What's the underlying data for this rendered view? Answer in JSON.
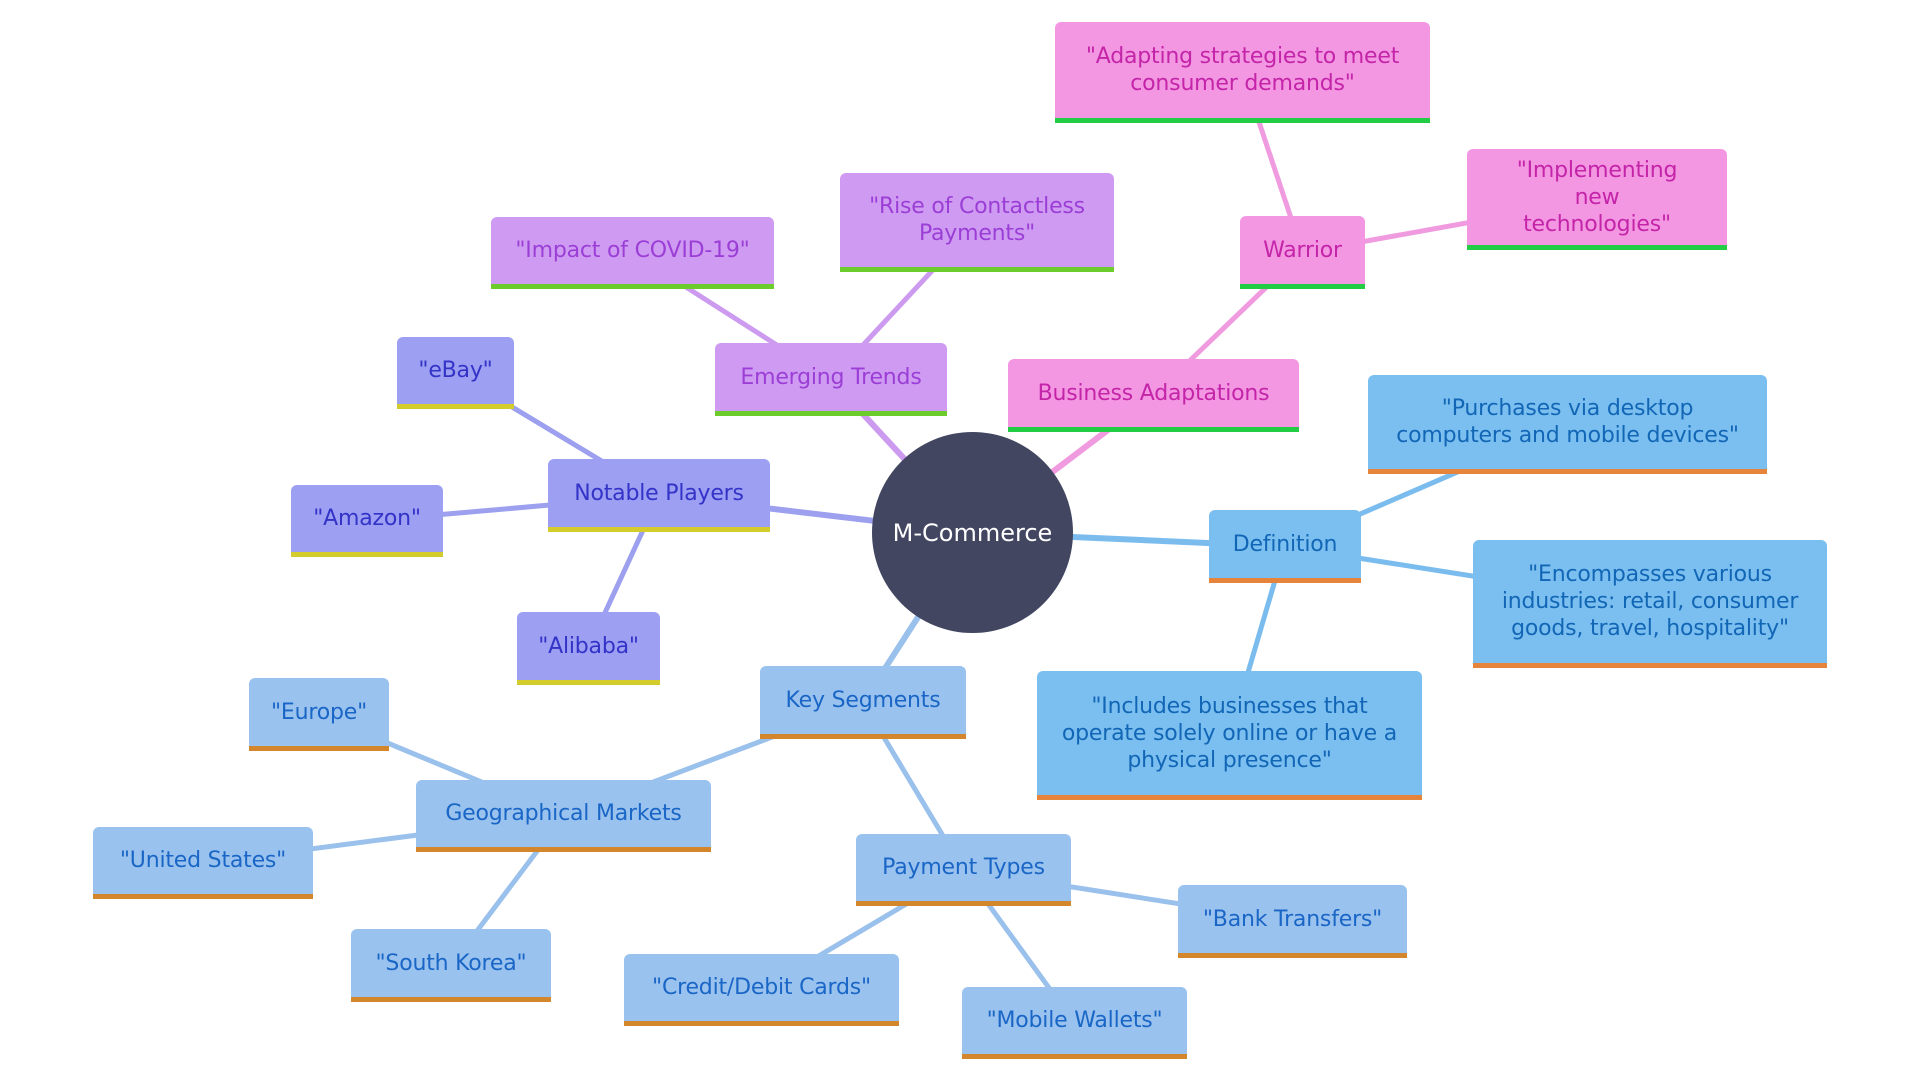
{
  "diagram": {
    "type": "mindmap",
    "root": {
      "id": "root",
      "label": "M-Commerce",
      "color": "#424660"
    },
    "group_colors": {
      "pink": {
        "fill": "#f497e3",
        "text": "#c324a8",
        "accent": "#22cc44",
        "edge": "#f09ae0"
      },
      "purple": {
        "fill": "#cf9bf2",
        "text": "#9b3ed6",
        "accent": "#6ccc2c",
        "edge": "#cc9bf0"
      },
      "indigo": {
        "fill": "#9c9ff2",
        "text": "#3333c8",
        "accent": "#d4cc2c",
        "edge": "#9ca0ee"
      },
      "sky": {
        "fill": "#7bbff0",
        "text": "#1266b6",
        "accent": "#e5843a",
        "edge": "#7bbcee"
      },
      "blue": {
        "fill": "#9ac2ee",
        "text": "#1a66c6",
        "accent": "#d4862c",
        "edge": "#9ac0ec"
      }
    },
    "nodes": [
      {
        "id": "business",
        "label": "Business Adaptations",
        "group": "pink",
        "parent": "root"
      },
      {
        "id": "warrior",
        "label": "Warrior",
        "group": "pink",
        "parent": "business"
      },
      {
        "id": "adapting",
        "label": "\"Adapting strategies to meet consumer demands\"",
        "group": "pink",
        "parent": "warrior"
      },
      {
        "id": "implementing",
        "label": "\"Implementing new technologies\"",
        "group": "pink",
        "parent": "warrior"
      },
      {
        "id": "emerging",
        "label": "Emerging Trends",
        "group": "purple",
        "parent": "root"
      },
      {
        "id": "covid",
        "label": "\"Impact of COVID-19\"",
        "group": "purple",
        "parent": "emerging"
      },
      {
        "id": "contactless",
        "label": "\"Rise of Contactless Payments\"",
        "group": "purple",
        "parent": "emerging"
      },
      {
        "id": "players",
        "label": "Notable Players",
        "group": "indigo",
        "parent": "root"
      },
      {
        "id": "ebay",
        "label": "\"eBay\"",
        "group": "indigo",
        "parent": "players"
      },
      {
        "id": "amazon",
        "label": "\"Amazon\"",
        "group": "indigo",
        "parent": "players"
      },
      {
        "id": "alibaba",
        "label": "\"Alibaba\"",
        "group": "indigo",
        "parent": "players"
      },
      {
        "id": "definition",
        "label": "Definition",
        "group": "sky",
        "parent": "root"
      },
      {
        "id": "purchases",
        "label": "\"Purchases via desktop computers and mobile devices\"",
        "group": "sky",
        "parent": "definition"
      },
      {
        "id": "encompasses",
        "label": "\"Encompasses various industries: retail, consumer goods, travel, hospitality\"",
        "group": "sky",
        "parent": "definition"
      },
      {
        "id": "includes",
        "label": "\"Includes businesses that operate solely online or have a physical presence\"",
        "group": "sky",
        "parent": "definition"
      },
      {
        "id": "segments",
        "label": "Key Segments",
        "group": "blue",
        "parent": "root"
      },
      {
        "id": "geo",
        "label": "Geographical Markets",
        "group": "blue",
        "parent": "segments"
      },
      {
        "id": "europe",
        "label": "\"Europe\"",
        "group": "blue",
        "parent": "geo"
      },
      {
        "id": "us",
        "label": "\"United States\"",
        "group": "blue",
        "parent": "geo"
      },
      {
        "id": "korea",
        "label": "\"South Korea\"",
        "group": "blue",
        "parent": "geo"
      },
      {
        "id": "payment",
        "label": "Payment Types",
        "group": "blue",
        "parent": "segments"
      },
      {
        "id": "bank",
        "label": "\"Bank Transfers\"",
        "group": "blue",
        "parent": "payment"
      },
      {
        "id": "credit",
        "label": "\"Credit/Debit Cards\"",
        "group": "blue",
        "parent": "payment"
      },
      {
        "id": "wallets",
        "label": "\"Mobile Wallets\"",
        "group": "blue",
        "parent": "payment"
      }
    ]
  }
}
